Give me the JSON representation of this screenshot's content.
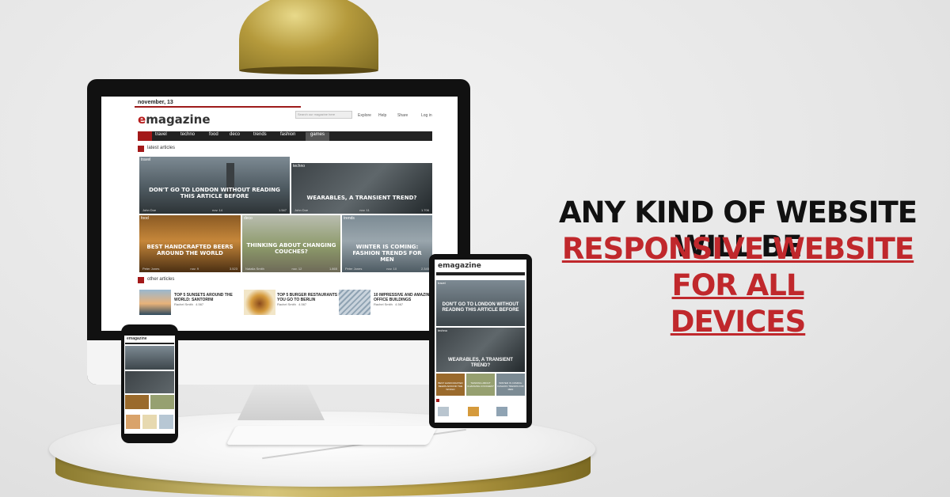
{
  "headline": {
    "line1": "ANY KIND OF WEBSITE WILL BE",
    "line2a": "RESPONSIVE WEBSITE FOR ALL",
    "line2b": "DEVICES"
  },
  "site": {
    "date": "november, 13",
    "logo_e": "e",
    "logo_rest": "magazine",
    "search_placeholder": "Search our magazine here",
    "nav_right": [
      "Explore",
      "Help",
      "Share",
      "Log in"
    ],
    "menu": [
      "travel",
      "techno",
      "food",
      "deco",
      "trends",
      "fashion",
      "games"
    ],
    "latest_heading": "latest articles",
    "other_heading": "other articles",
    "latest": [
      {
        "cat": "travel",
        "title": "DON'T GO TO LONDON WITHOUT READING THIS ARTICLE BEFORE",
        "author": "John Doe",
        "date": "nov. 14",
        "count": "1.547"
      },
      {
        "cat": "techno",
        "title": "WEARABLES, A TRANSIENT TREND?",
        "author": "John Doe",
        "date": "nov. 11",
        "count": "1.706"
      },
      {
        "cat": "food",
        "title": "BEST HANDCRAFTED BEERS AROUND THE WORLD",
        "author": "Peter Jones",
        "date": "nov. 9",
        "count": "3.523"
      },
      {
        "cat": "deco",
        "title": "THINKING ABOUT CHANGING COUCHES?",
        "author": "Natalia Smith",
        "date": "nov. 12",
        "count": "1.865"
      },
      {
        "cat": "trends",
        "title": "WINTER IS COMING: FASHION TRENDS FOR MEN",
        "author": "Peter Jones",
        "date": "nov. 10",
        "count": "2.345"
      }
    ],
    "other": [
      {
        "title": "TOP 5 SUNSETS AROUND THE WORLD: SANTORINI",
        "author": "Rachel Smith",
        "count": "4.567"
      },
      {
        "title": "TOP 5 BURGER RESTAURANTS IF YOU GO TO BERLIN",
        "author": "Rachel Smith",
        "count": "4.567"
      },
      {
        "title": "10 IMPRESSIVE AND AMAZING OFFICE BUILDINGS",
        "author": "Rachel Smith",
        "count": "4.567"
      }
    ]
  },
  "tablet": {
    "logo": "emagazine",
    "tiles": [
      {
        "cat": "travel",
        "title": "DON'T GO TO LONDON WITHOUT READING THIS ARTICLE BEFORE"
      },
      {
        "cat": "techno",
        "title": "WEARABLES, A TRANSIENT TREND?"
      }
    ],
    "small_tiles": [
      "BEST HANDCRAFTED BEERS AROUND THE WORLD",
      "THINKING ABOUT CHANGING COUCHES?",
      "WINTER IS COMING: FASHION TRENDS FOR MEN"
    ]
  },
  "phone": {
    "logo": "emagazine"
  },
  "colors": {
    "accent": "#a31919",
    "headline_red": "#c0282c"
  }
}
